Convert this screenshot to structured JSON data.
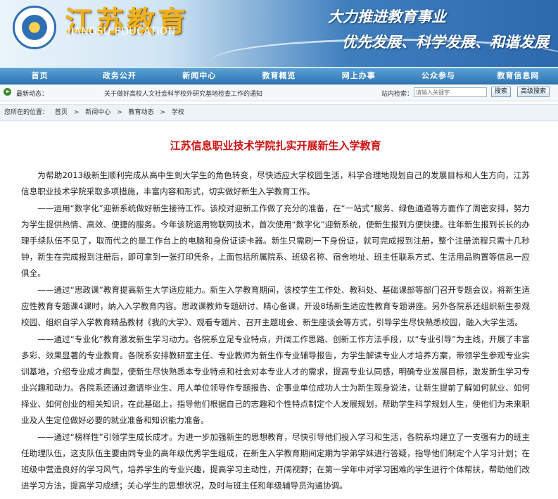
{
  "banner": {
    "brand_cn": "江苏教育",
    "brand_en": "JIANGSU EDUCATION",
    "slogan_line1": "大力推进教育事业",
    "slogan_line2": "优先发展、科学发展、和谐发展"
  },
  "nav": {
    "items": [
      "首页",
      "政务公开",
      "新闻中心",
      "教育概览",
      "网上办事",
      "公众参与",
      "教育信息网"
    ]
  },
  "infobar": {
    "latest_label": "最新动态：",
    "latest_news": "关于做好高校人文社会科学校外研究基地检查工作的通知",
    "search_label": "站内检索：",
    "search_placeholder": "请输入关键字",
    "search_button": "搜索",
    "advanced_button": "高级搜索"
  },
  "breadcrumb": {
    "prefix": "您所在的位置：",
    "items": [
      "首页",
      "新闻中心",
      "教育动态",
      "学校"
    ],
    "separator": ">"
  },
  "article": {
    "title": "江苏信息职业技术学院扎实开展新生入学教育",
    "paragraphs": [
      "为帮助2013级新生顺利完成从高中生到大学生的角色转变，尽快适应大学校园生活，科学合理地规划自己的发展目标和人生方向，江苏信息职业技术学院采取多项措施，丰富内容和形式，切实做好新生入学教育工作。",
      "——运用“数字化”迎新系统做好新生接待工作。该校对迎新工作做了充分的准备，在“一站式”服务、绿色通道等方面作了周密安排，努力为学生提供热情、高效、便捷的服务。今年该院运用物联网技术，首次使用“数字化”迎新系统，使新生报到方便快捷。往年新生报到长长的办理手续队伍不见了，取而代之的是工作台上的电脑和身份证读卡器。新生只需刷一下身份证，就可完成报到注册，整个注册流程只需十几秒钟，新生在完成报到注册后，即可拿到一张打印凭条，上面包括所属院系、班级名称、宿舍地址、班主任联系方式、生活用品购置等信息一应俱全。",
      "——通过“思政课”教育提高新生大学适应能力。新生入学教育期间，该校学生工作处、教科处、基础课部等部门召开专题会议，将新生适应性教育专题课4课时，纳入入学教育内容。思政课教师专题研讨、精心备课，开设8场新生适应性教育专题讲座。另外各院系还组织新生参观校园、组织自学入学教育精品教材《我的大学》、观看专题片、召开主题班会、新生座谈会等方式，引导学生尽快熟悉校园，融入大学生活。",
      "——通过“专业化”教育激发新生学习动力。各院系立足专业特点，开阔工作思路、创新工作方法手段，以“专业引导”为主线，开展了丰富多彩、效果显著的专业教育。各院系安排教研室主任、专业教师为新生作专业辅导报告，为学生解读专业人才培养方案，带领学生参观专业实训基地，介绍专业成才典型，使新生尽快熟悉本专业特点和社会对本专业人才的需求，提高专业认同感，明确专业发展目标，激发新生学习专业兴趣和动力。各院系还通过邀请毕业生、用人单位领导作专题报告、企事业单位成功人士为新生现身说法，让新生提前了解如何就业、如何择业、如何创业的相关知识，在此基础上，指导他们根据自己的志趣和个性特点制定个人发展规划，帮助学生科学规划人生，使他们为未来职业及人生定位做好必要的就业准备和知识能力准备。",
      "——通过“榜样性”引领学生成长成才。为进一步加强新生的思想教育，尽快引导他们投入学习和生活，各院系均建立了一支强有力的班主任助理队伍，这支队伍主要由同专业的高年级优秀学生组成，在新生入学教育期间定期为学弟学妹进行答疑，指导他们制定个人学习计划；在班级中营造良好的学习风气，培养学生的专业兴趣，提高学习主动性，开阔视野；在第一学年中对学习困难的学生进行个体帮扶，帮助他们改进学习方法，提高学习成绩；关心学生的思想状况，及时与班主任和年级辅导员沟通协调。"
    ]
  }
}
